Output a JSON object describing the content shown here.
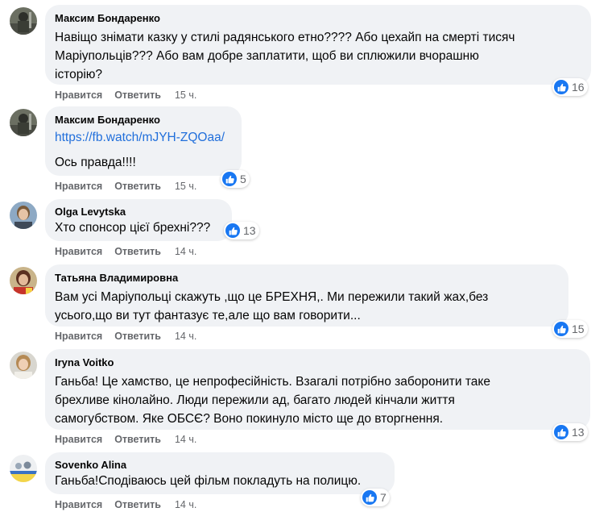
{
  "comments": [
    {
      "author": "Максим Бондаренко",
      "text": "Навіщо знімати казку у стилі радянського етно???? Або цехайп на смерті тисяч\nМаріупольців??? Або вам добре заплатити, щоб ви сплюжили вчорашню\nісторію?",
      "like_label": "Нравится",
      "reply_label": "Ответить",
      "time": "15 ч.",
      "reactions": "16"
    },
    {
      "author": "Максим Бондаренко",
      "link": "https://fb.watch/mJYH-ZQOaa/",
      "text": "Ось правда!!!!",
      "like_label": "Нравится",
      "reply_label": "Ответить",
      "time": "15 ч.",
      "reactions": "5"
    },
    {
      "author": "Olga Levytska",
      "text": "Хто спонсор цієї брехні???",
      "like_label": "Нравится",
      "reply_label": "Ответить",
      "time": "14 ч.",
      "reactions": "13"
    },
    {
      "author": "Татьяна Владимировна",
      "text": "Вам усі Маріупольці скажуть ,що це БРЕХНЯ,. Ми пережили такий жах,без\nусього,що ви тут фантазує те,але що вам говорити...",
      "like_label": "Нравится",
      "reply_label": "Ответить",
      "time": "14 ч.",
      "reactions": "15"
    },
    {
      "author": "Iryna Voitko",
      "text": "Ганьба! Це хамство, це непрофесійність. Взагалі потрібно заборонити таке\nбрехливе кінолайно. Люди пережили ад, багато людей кінчали життя\nсамогубством. Яке ОБСЄ? Воно покинуло місто ще до вторгнення.",
      "like_label": "Нравится",
      "reply_label": "Ответить",
      "time": "14 ч.",
      "reactions": "13"
    },
    {
      "author": "Sovenko Alina",
      "text": "Ганьба!Сподіваюсь цей фільм покладуть на полицю.",
      "like_label": "Нравится",
      "reply_label": "Ответить",
      "time": "14 ч.",
      "reactions": "7"
    }
  ],
  "colors": {
    "bubble": "#f0f2f5",
    "link": "#216fdb",
    "meta": "#65676b",
    "like": "#1877f2"
  },
  "icons": {
    "reaction": "thumbs-up-icon"
  }
}
